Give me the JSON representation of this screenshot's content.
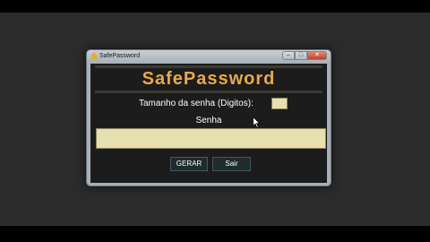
{
  "window": {
    "title": "SafePassword",
    "controls": {
      "minimize": "–",
      "maximize": "□",
      "close": "✕"
    }
  },
  "app": {
    "heading": "SafePassword",
    "password_length_label": "Tamanho da senha (Digitos):",
    "password_length_value": "",
    "password_label": "Senha",
    "password_value": "",
    "generate_button": "GERAR",
    "exit_button": "Sair"
  },
  "colors": {
    "heading": "#e7a94a",
    "field_background": "#e8dfb0",
    "client_background": "#1c1c1c",
    "button_background": "#1f2b2c"
  }
}
